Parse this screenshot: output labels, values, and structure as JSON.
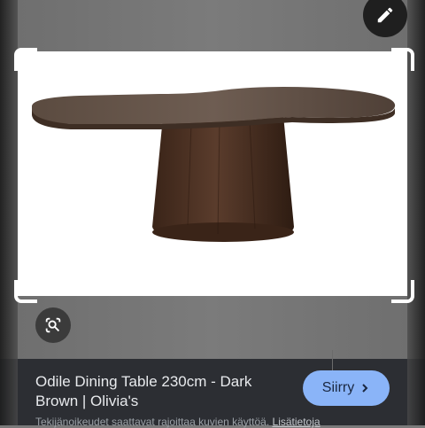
{
  "result": {
    "title": "Odile Dining Table 230cm - Dark Brown | Olivia's",
    "goto_label": "Siirry",
    "copyright_text": "Tekijänoikeudet saattavat rajoittaa kuvien käyttöä.",
    "more_info_label": "Lisätietoja"
  },
  "icons": {
    "edit": "pencil-icon",
    "lens": "lens-search-icon",
    "goto": "chevron-right-icon"
  },
  "colors": {
    "accent": "#8ab4f8",
    "panel": "#2c2e33",
    "table_wood": "#4a3326"
  }
}
